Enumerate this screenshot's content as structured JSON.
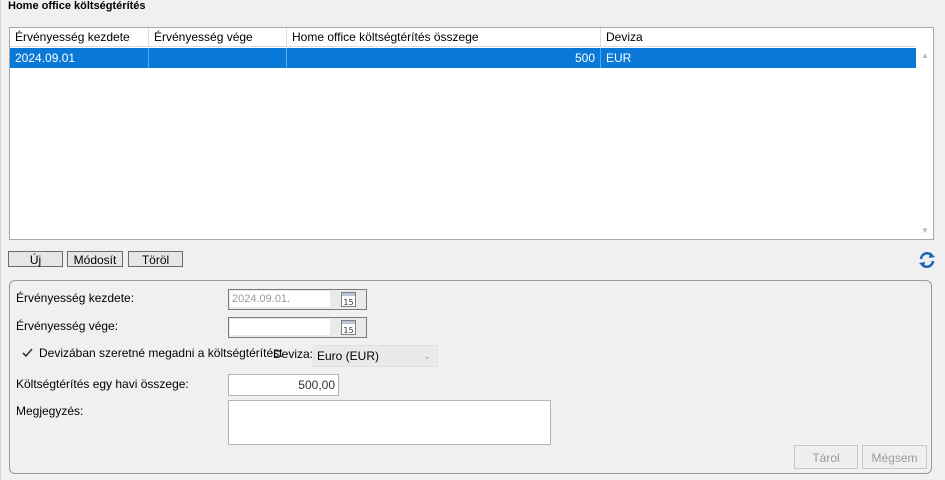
{
  "panel_title": "Home office költségtérítés",
  "table": {
    "columns": [
      "Érvényesség kezdete",
      "Érvényesség vége",
      "Home office költségtérítés összege",
      "Deviza"
    ],
    "rows": [
      {
        "start": "2024.09.01",
        "end": "",
        "amount": "500",
        "currency": "EUR",
        "selected": true
      }
    ]
  },
  "toolbar": {
    "new_label": "Új",
    "modify_label": "Módosít",
    "delete_label": "Töröl",
    "refresh_icon": "refresh-icon"
  },
  "form": {
    "valid_from_label": "Érvényesség kezdete:",
    "valid_from_value": "2024.09.01.",
    "valid_to_label": "Érvényesség vége:",
    "valid_to_value": "",
    "calendar_icon_text": "15",
    "currency_checkbox_label": "Devizában szeretné megadni a költségtérítést",
    "currency_checkbox_checked": true,
    "currency_label": "Deviza:",
    "currency_value": "Euro (EUR)",
    "monthly_amount_label": "Költségtérítés egy havi összege:",
    "monthly_amount_value": "500,00",
    "note_label": "Megjegyzés:",
    "note_value": "",
    "save_label": "Tárol",
    "cancel_label": "Mégsem"
  },
  "colors": {
    "selection": "#0a78d7",
    "background": "#f0f0f0"
  }
}
